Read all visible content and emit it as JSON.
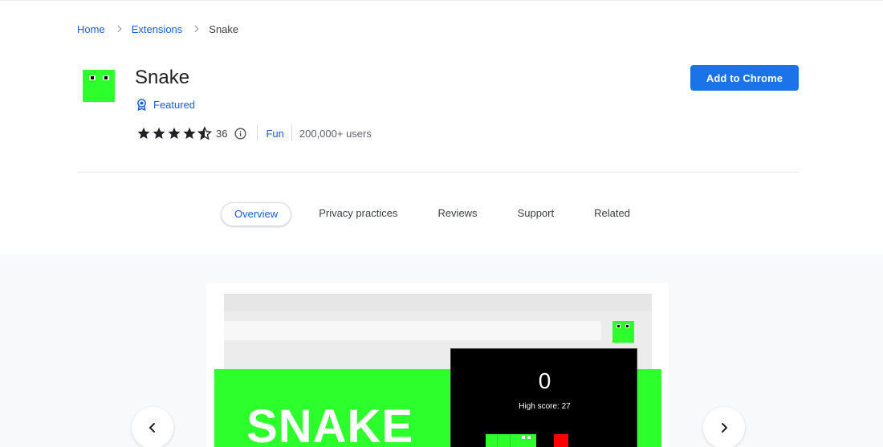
{
  "breadcrumb": {
    "home": "Home",
    "extensions": "Extensions",
    "current": "Snake"
  },
  "header": {
    "title": "Snake",
    "featured_label": "Featured",
    "rating": 4.5,
    "rating_count": "36",
    "category": "Fun",
    "users": "200,000+ users",
    "add_button": "Add to Chrome"
  },
  "tabs": [
    {
      "label": "Overview",
      "active": true
    },
    {
      "label": "Privacy practices",
      "active": false
    },
    {
      "label": "Reviews",
      "active": false
    },
    {
      "label": "Support",
      "active": false
    },
    {
      "label": "Related",
      "active": false
    }
  ],
  "screenshot": {
    "banner_text": "SNAKE",
    "score": "0",
    "high_score": "High score: 27"
  },
  "colors": {
    "link": "#1a5fd0",
    "primary_button": "#1a73e8",
    "snake_green": "#2cff2c",
    "food_red": "#ff0000"
  },
  "icons": {
    "prev": "chevron-left-icon",
    "next": "chevron-right-icon",
    "featured": "award-badge-icon",
    "info": "info-icon"
  }
}
